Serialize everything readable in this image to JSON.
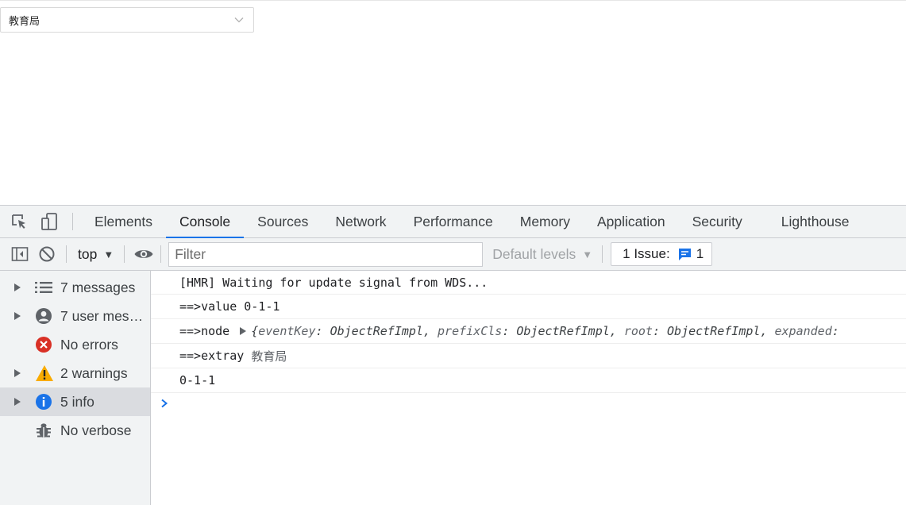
{
  "page": {
    "tree_select": {
      "value": "教育局"
    }
  },
  "devtools": {
    "tabs": [
      {
        "label": "Elements"
      },
      {
        "label": "Console"
      },
      {
        "label": "Sources"
      },
      {
        "label": "Network"
      },
      {
        "label": "Performance"
      },
      {
        "label": "Memory"
      },
      {
        "label": "Application"
      },
      {
        "label": "Security"
      },
      {
        "label": "Lighthouse"
      }
    ],
    "active_tab": "Console",
    "toolbar": {
      "context": "top",
      "filter_placeholder": "Filter",
      "levels": "Default levels",
      "issues_label": "1 Issue:",
      "issues_count": "1"
    },
    "sidebar": [
      {
        "label": "7 messages",
        "icon": "list-icon",
        "expandable": true
      },
      {
        "label": "7 user mess…",
        "icon": "user-icon",
        "expandable": true
      },
      {
        "label": "No errors",
        "icon": "error-icon",
        "expandable": false
      },
      {
        "label": "2 warnings",
        "icon": "warning-icon",
        "expandable": true
      },
      {
        "label": "5 info",
        "icon": "info-icon",
        "expandable": true,
        "selected": true
      },
      {
        "label": "No verbose",
        "icon": "bug-icon",
        "expandable": false
      }
    ],
    "messages": {
      "hmr": "[HMR] Waiting for update signal from WDS...",
      "value": "==>value 0-1-1",
      "node_prefix": "==>node",
      "node_obj": {
        "open": "{",
        "k1": "eventKey",
        "v1": "ObjectRefImpl",
        "k2": "prefixCls",
        "v2": "ObjectRefImpl",
        "k3": "root",
        "v3": "ObjectRefImpl",
        "k4": "expanded"
      },
      "extray_prefix": "==>extray",
      "extray_value": "教育局",
      "plain": "0-1-1"
    },
    "colors": {
      "accent": "#1a73e8",
      "error": "#d93025",
      "warning": "#f9ab00",
      "info": "#1a73e8"
    }
  }
}
